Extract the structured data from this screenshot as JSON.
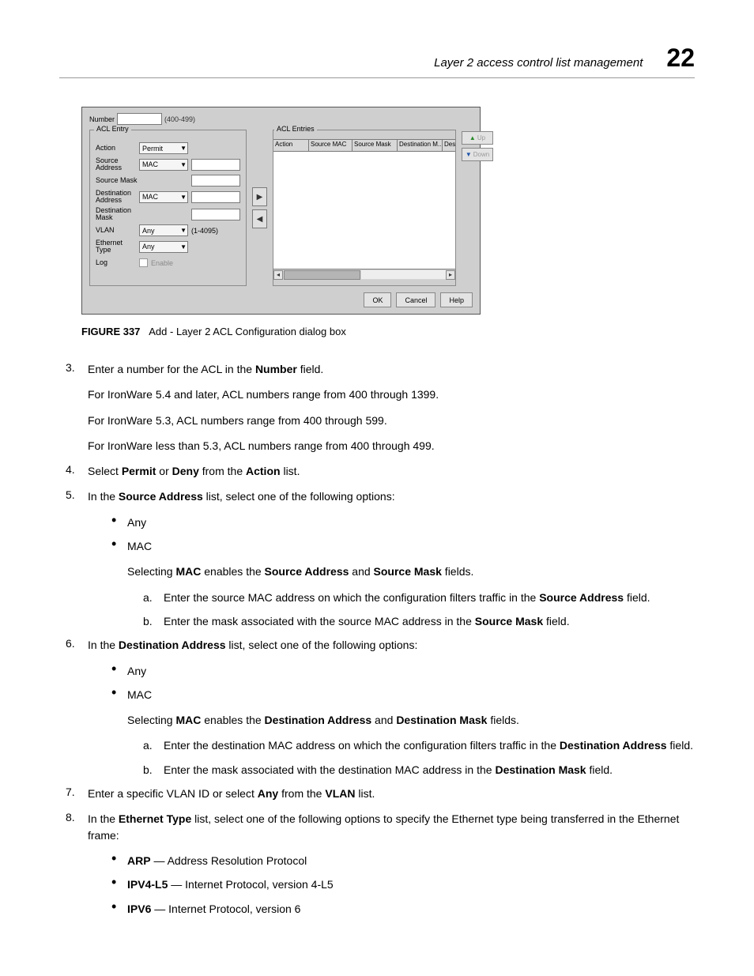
{
  "header": {
    "title": "Layer 2 access control list management",
    "page_number": "22"
  },
  "dialog": {
    "number_label": "Number",
    "number_range": "(400-499)",
    "left_panel_title": "ACL Entry",
    "right_panel_title": "ACL Entries",
    "fields": {
      "action": {
        "label": "Action",
        "value": "Permit"
      },
      "source_address": {
        "label": "Source Address",
        "value": "MAC"
      },
      "source_mask": {
        "label": "Source Mask"
      },
      "dest_address": {
        "label": "Destination Address",
        "value": "MAC"
      },
      "dest_mask": {
        "label": "Destination Mask"
      },
      "vlan": {
        "label": "VLAN",
        "value": "Any",
        "hint": "(1-4095)"
      },
      "eth_type": {
        "label": "Ethernet Type",
        "value": "Any"
      },
      "log": {
        "label": "Log",
        "checkbox": "Enable"
      }
    },
    "table_headers": [
      "Action",
      "Source MAC",
      "Source Mask",
      "Destination M...",
      "Destinat"
    ],
    "up_label": "Up",
    "down_label": "Down",
    "buttons": {
      "ok": "OK",
      "cancel": "Cancel",
      "help": "Help"
    }
  },
  "figure": {
    "label": "FIGURE 337",
    "caption": "Add - Layer 2 ACL Configuration dialog box"
  },
  "steps": {
    "s3": {
      "line1_a": "Enter a number for the ACL in the ",
      "line1_b": "Number",
      "line1_c": " field.",
      "line2": "For IronWare 5.4 and later, ACL numbers range from 400 through 1399.",
      "line3": "For IronWare 5.3, ACL numbers range from 400 through 599.",
      "line4": "For IronWare less than 5.3, ACL numbers range from 400 through 499."
    },
    "s4": {
      "a": "Select ",
      "b": "Permit",
      "c": " or ",
      "d": "Deny",
      "e": " from the ",
      "f": "Action",
      "g": " list."
    },
    "s5": {
      "a": "In the ",
      "b": "Source Address",
      "c": " list, select one of the following options:",
      "any": "Any",
      "mac": "MAC",
      "mac_line_a": "Selecting ",
      "mac_line_b": "MAC",
      "mac_line_c": " enables the ",
      "mac_line_d": "Source Address",
      "mac_line_e": " and ",
      "mac_line_f": "Source Mask",
      "mac_line_g": " fields.",
      "alpha_a_a": "Enter the source MAC address on which the configuration filters traffic in the ",
      "alpha_a_b": "Source Address",
      "alpha_a_c": " field.",
      "alpha_b_a": "Enter the mask associated with the source MAC address in the ",
      "alpha_b_b": "Source Mask",
      "alpha_b_c": " field."
    },
    "s6": {
      "a": "In the ",
      "b": "Destination Address",
      "c": " list, select one of the following options:",
      "any": "Any",
      "mac": "MAC",
      "mac_line_a": "Selecting ",
      "mac_line_b": "MAC",
      "mac_line_c": " enables the ",
      "mac_line_d": "Destination Address",
      "mac_line_e": " and ",
      "mac_line_f": "Destination Mask",
      "mac_line_g": " fields.",
      "alpha_a_a": "Enter the destination MAC address on which the configuration filters traffic in the ",
      "alpha_a_b": "Destination Address",
      "alpha_a_c": " field.",
      "alpha_b_a": "Enter the mask associated with the destination MAC address in the ",
      "alpha_b_b": "Destination Mask",
      "alpha_b_c": " field."
    },
    "s7": {
      "a": "Enter a specific VLAN ID or select ",
      "b": "Any",
      "c": " from the ",
      "d": "VLAN",
      "e": " list."
    },
    "s8": {
      "a": "In the ",
      "b": "Ethernet Type",
      "c": " list, select one of the following options to specify the Ethernet type being transferred in the Ethernet frame:",
      "arp_b": "ARP",
      "arp_t": " — Address Resolution Protocol",
      "ipv4_b": "IPV4-L5",
      "ipv4_t": " — Internet Protocol, version 4-L5",
      "ipv6_b": "IPV6",
      "ipv6_t": " — Internet Protocol, version 6"
    }
  }
}
